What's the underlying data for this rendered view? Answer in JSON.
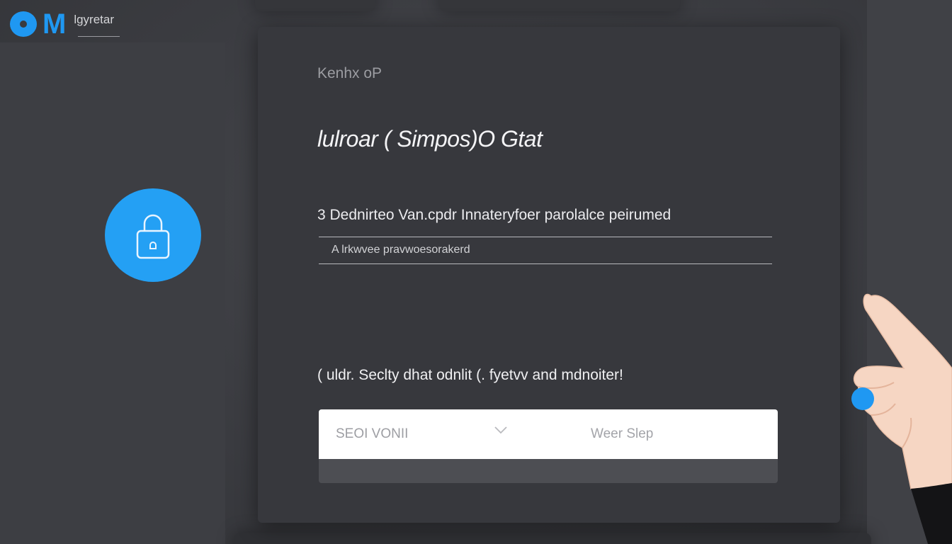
{
  "logo": {
    "letter_o": "",
    "letter_m": "M",
    "wordmark": "lgyretar",
    "brand_color": "#1f98f2"
  },
  "sidebar": {
    "lock_icon": "lock-icon",
    "circle_color": "#24a0f4"
  },
  "card": {
    "header": "Kenhx oP",
    "title": "lulroar ( Simpos)O Gtat",
    "description": "3 Dednirteo Van.cpdr Innateryfoer parolalce peirumed",
    "hint": "A lrkwvee pravwoesorakerd",
    "prompt": "( uldr. Seclty dhat odnlit (. fyetvv and mdnoiter!",
    "select": {
      "left_value": "SEOI VONII",
      "chevron_icon": "chevron-down-icon",
      "right_value": "Weer Slep"
    }
  },
  "decor": {
    "hand_icon": "pointing-hand-icon",
    "fingertip_color": "#1f98f2"
  }
}
